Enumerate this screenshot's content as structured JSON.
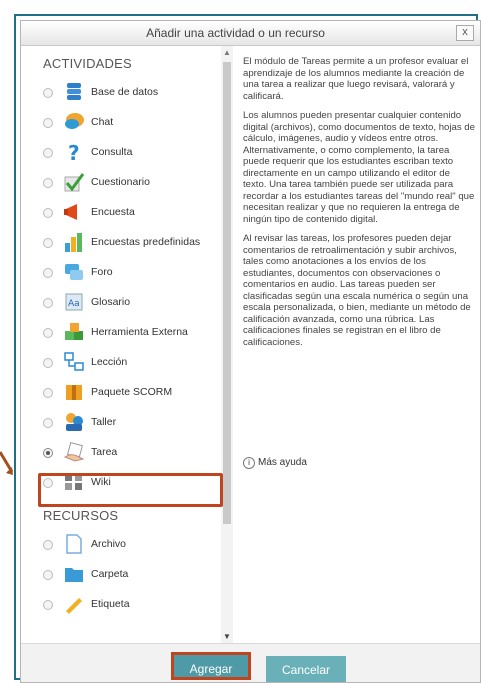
{
  "dialog": {
    "title": "Añadir una actividad o un recurso",
    "close_label": "x"
  },
  "sections": {
    "activities": "ACTIVIDADES",
    "resources": "RECURSOS"
  },
  "activities": [
    {
      "label": "Base de datos",
      "icon": "database-icon"
    },
    {
      "label": "Chat",
      "icon": "chat-icon"
    },
    {
      "label": "Consulta",
      "icon": "question-icon"
    },
    {
      "label": "Cuestionario",
      "icon": "quiz-checkmark-icon"
    },
    {
      "label": "Encuesta",
      "icon": "megaphone-icon"
    },
    {
      "label": "Encuestas predefinidas",
      "icon": "bar-chart-icon"
    },
    {
      "label": "Foro",
      "icon": "forum-icon"
    },
    {
      "label": "Glosario",
      "icon": "glossary-icon"
    },
    {
      "label": "Herramienta Externa",
      "icon": "puzzle-icon"
    },
    {
      "label": "Lección",
      "icon": "lesson-icon"
    },
    {
      "label": "Paquete SCORM",
      "icon": "package-icon"
    },
    {
      "label": "Taller",
      "icon": "workshop-icon"
    },
    {
      "label": "Tarea",
      "icon": "assignment-hand-icon",
      "selected": true
    },
    {
      "label": "Wiki",
      "icon": "wiki-icon"
    }
  ],
  "resources": [
    {
      "label": "Archivo",
      "icon": "file-icon"
    },
    {
      "label": "Carpeta",
      "icon": "folder-icon"
    },
    {
      "label": "Etiqueta",
      "icon": "label-pencil-icon"
    }
  ],
  "description": {
    "p1": "El módulo de Tareas permite a un profesor evaluar el aprendizaje de los alumnos mediante la creación de una tarea a realizar que luego revisará, valorará y calificará.",
    "p2": "Los alumnos pueden presentar cualquier contenido digital (archivos), como documentos de texto, hojas de cálculo, imágenes, audio y vídeos entre otros. Alternativamente, o como complemento, la tarea puede requerir que los estudiantes escriban texto directamente en un campo utilizando el editor de texto. Una tarea también puede ser utilizada para recordar a los estudiantes tareas del \"mundo real\" que necesitan realizar y que no requieren la entrega de ningún tipo de contenido digital.",
    "p3": "Al revisar las tareas, los profesores pueden dejar comentarios de retroalimentación y subir archivos, tales como anotaciones a los envíos de los estudiantes, documentos con observaciones o comentarios en audio. Las tareas pueden ser clasificadas según una escala numérica o según una escala personalizada, o bien, mediante un método de calificación avanzada, como una rúbrica. Las calificaciones finales se registran en el libro de calificaciones.",
    "more_help": "Más ayuda"
  },
  "footer": {
    "add_label": "Agregar",
    "cancel_label": "Cancelar"
  },
  "colors": {
    "accent_frame": "#1f6f88",
    "highlight": "#c0451e",
    "button": "#4e9aa6"
  }
}
